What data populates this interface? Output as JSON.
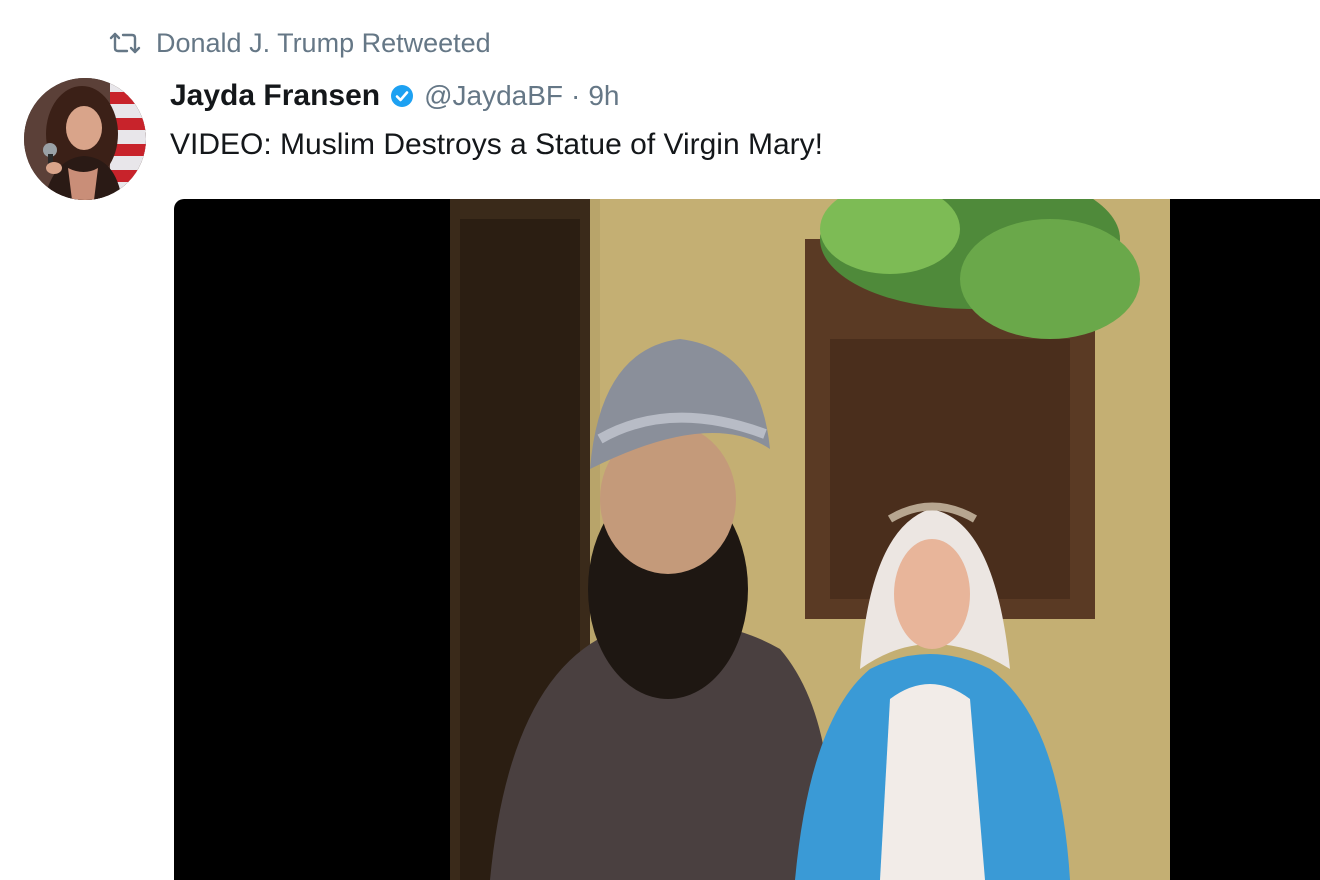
{
  "retweet_context": {
    "icon": "retweet-icon",
    "text": "Donald J. Trump Retweeted"
  },
  "tweet": {
    "author_name": "Jayda Fransen",
    "verified": true,
    "handle": "@JaydaBF",
    "separator": "·",
    "time": "9h",
    "text": "VIDEO: Muslim Destroys a Statue of Virgin Mary!"
  },
  "colors": {
    "text_primary": "#14171a",
    "text_secondary": "#657786",
    "verified_blue": "#1da1f2",
    "media_background": "#000000"
  }
}
